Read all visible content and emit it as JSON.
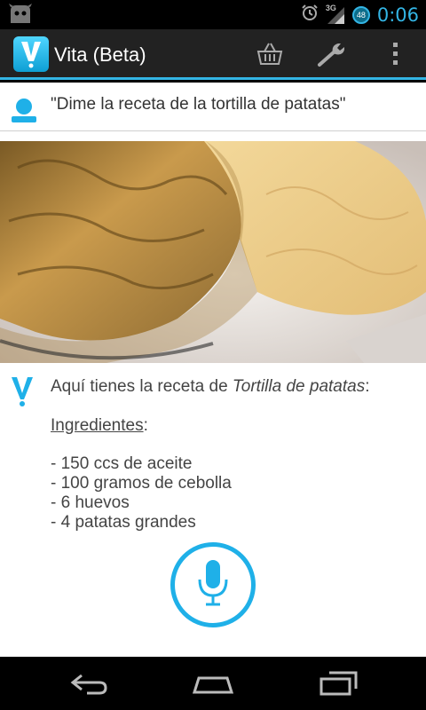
{
  "status_bar": {
    "time": "0:06",
    "battery": "48",
    "network": "3G",
    "icons": [
      "cyanogen-icon",
      "alarm-icon",
      "signal-icon",
      "battery-icon"
    ]
  },
  "action_bar": {
    "title": "Vita (Beta)",
    "actions": [
      "basket-icon",
      "wrench-icon",
      "overflow-menu-icon"
    ],
    "accent_color": "#33b5e5"
  },
  "conversation": {
    "query": "\"Dime la receta de la tortilla de patatas\"",
    "answer_intro": "Aquí tienes la receta de ",
    "answer_dish": "Tortilla de patatas",
    "answer_colon": ":",
    "ingredients_label": "Ingredientes",
    "ingredients_colon": ":",
    "ingredients": [
      "- 150 ccs de aceite",
      "- 100 gramos de cebolla",
      "- 6 huevos",
      "- 4 patatas grandes"
    ]
  },
  "colors": {
    "accent": "#1fb0e8",
    "action_bar_bg": "#222222",
    "content_bg": "#ffffff"
  },
  "nav_bar": {
    "buttons": [
      "back-icon",
      "home-icon",
      "recent-apps-icon"
    ]
  }
}
